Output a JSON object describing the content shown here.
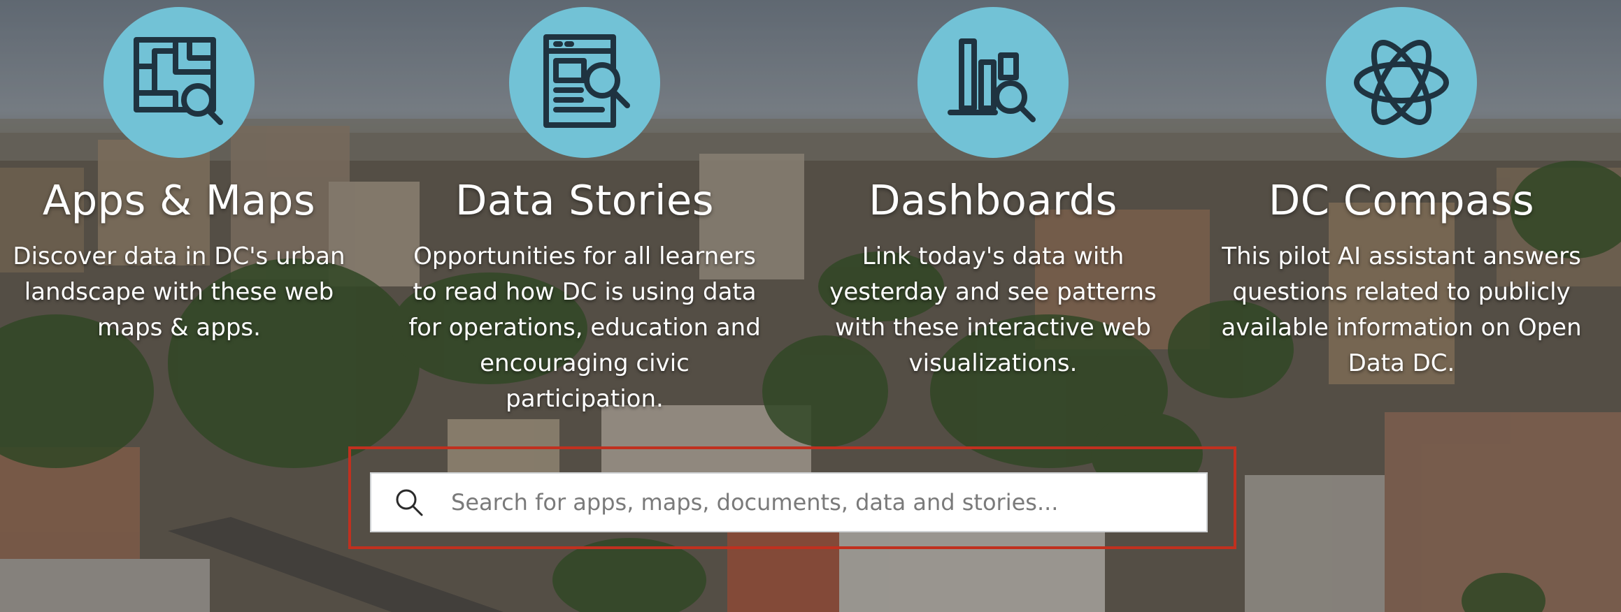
{
  "cards": [
    {
      "title": "Apps & Maps",
      "description": "Discover data in DC's urban landscape with these web maps & apps.",
      "icon": "map-magnifier-icon"
    },
    {
      "title": "Data Stories",
      "description": "Opportunities for all learners to read how DC is using data for operations, education and encouraging civic participation.",
      "icon": "document-magnifier-icon"
    },
    {
      "title": "Dashboards",
      "description": "Link today's data with yesterday and see patterns with these interactive web visualizations.",
      "icon": "bar-chart-magnifier-icon"
    },
    {
      "title": "DC Compass",
      "description": "This pilot AI assistant answers questions related to publicly available information on Open Data DC.",
      "icon": "atom-icon"
    }
  ],
  "search": {
    "placeholder": "Search for apps, maps, documents, data and stories...",
    "value": ""
  },
  "colors": {
    "icon_circle": "#72c2d6",
    "icon_stroke": "#1f3340",
    "highlight_border": "#c0301f"
  }
}
